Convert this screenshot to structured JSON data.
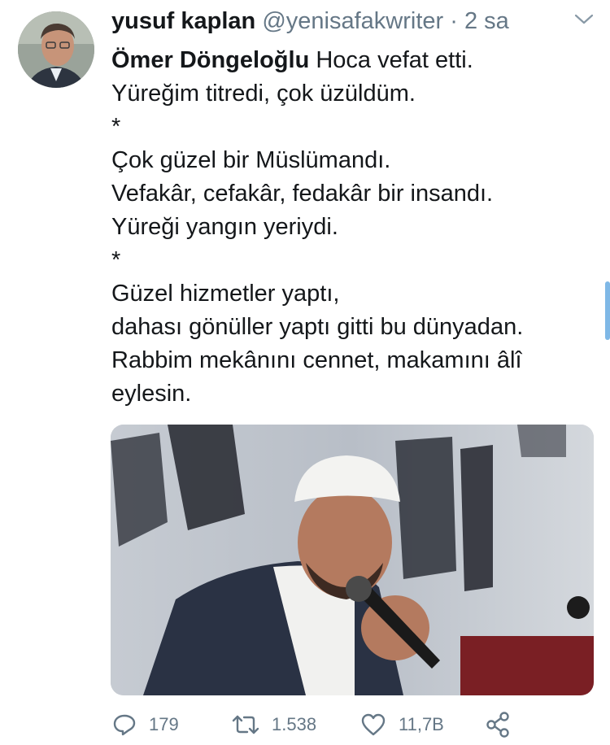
{
  "tweet": {
    "author": {
      "name": "yusuf kaplan",
      "handle": "@yenisafakwriter",
      "separator": "·",
      "time": "2 sa"
    },
    "lines": [
      {
        "mention": "Ömer Döngeloğlu",
        "text": " Hoca vefat etti."
      },
      {
        "mention": "",
        "text": "Yüreğim titredi, çok üzüldüm."
      },
      {
        "mention": "",
        "text": "*"
      },
      {
        "mention": "",
        "text": "Çok güzel bir Müslümandı."
      },
      {
        "mention": "",
        "text": "Vefakâr, cefakâr, fedakâr bir insandı."
      },
      {
        "mention": "",
        "text": "Yüreği yangın yeriydi."
      },
      {
        "mention": "",
        "text": "*"
      },
      {
        "mention": "",
        "text": "Güzel hizmetler yaptı,"
      },
      {
        "mention": "",
        "text": "dahası gönüller yaptı gitti bu dünyadan."
      },
      {
        "mention": "",
        "text": "Rabbim mekânını cennet, makamını âlî"
      },
      {
        "mention": "",
        "text": "eylesin."
      }
    ],
    "actions": {
      "reply_count": "179",
      "retweet_count": "1.538",
      "like_count": "11,7B"
    },
    "icons": [
      "chevron-down-icon",
      "reply-icon",
      "retweet-icon",
      "like-icon",
      "share-icon"
    ],
    "colors": {
      "text": "#14171a",
      "secondary": "#657786"
    }
  }
}
